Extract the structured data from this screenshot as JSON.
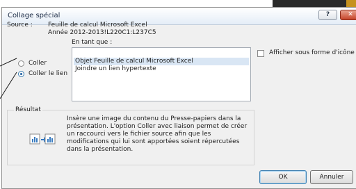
{
  "dialog": {
    "title": "Collage spécial",
    "help_label": "?",
    "close_label": "✕"
  },
  "source": {
    "label": "Source :",
    "line1": "Feuille de calcul Microsoft Excel",
    "line2": "Année 2012-2013!L220C1:L237C5"
  },
  "as_label": "En tant que :",
  "options": {
    "paste_label": "Coller",
    "paste_link_label": "Coller le lien",
    "selected": "Coller le lien"
  },
  "list": {
    "items": [
      "Objet Feuille de calcul Microsoft Excel",
      "Joindre un lien hypertexte"
    ],
    "selected_index": 0
  },
  "display_as_icon": {
    "label": "Afficher sous forme d'icône",
    "checked": false
  },
  "result": {
    "title": "Résultat",
    "lines": [
      "Insère une image du contenu du Presse-papiers dans la",
      "présentation. L'option Coller avec liaison permet de créer",
      "un raccourci vers le fichier source afin que les",
      "modifications qui lui sont apportées soient répercutées",
      "dans la présentation."
    ],
    "icon": "paste-link-icon"
  },
  "buttons": {
    "ok": "OK",
    "cancel": "Annuler"
  }
}
